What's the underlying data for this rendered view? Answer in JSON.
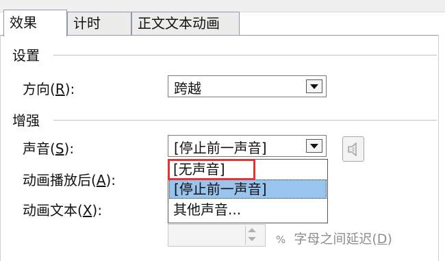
{
  "tabs": [
    {
      "label": "效果",
      "active": true
    },
    {
      "label": "计时",
      "active": false
    },
    {
      "label": "正文文本动画",
      "active": false
    }
  ],
  "settings": {
    "group_label": "设置",
    "direction": {
      "label": "方向",
      "hotkey": "R",
      "value": "跨越"
    }
  },
  "enhance": {
    "group_label": "增强",
    "sound": {
      "label": "声音",
      "hotkey": "S",
      "value": "[停止前一声音]"
    },
    "after_animation": {
      "label": "动画播放后",
      "hotkey": "A"
    },
    "animate_text": {
      "label": "动画文本",
      "hotkey": "X"
    },
    "delay_between_letters": {
      "value": "",
      "unit": "%",
      "label": "字母之间延迟",
      "hotkey": "D"
    }
  },
  "sound_dropdown": {
    "options": [
      "[无声音]",
      "[停止前一声音]",
      "其他声音..."
    ],
    "selected_index": 1,
    "highlighted_index": 0,
    "highlight_color": "#e23434",
    "selected_color": "#99c4ee"
  },
  "icons": [
    "dropdown-arrow-icon",
    "speaker-icon",
    "spin-up-icon",
    "spin-down-icon"
  ]
}
